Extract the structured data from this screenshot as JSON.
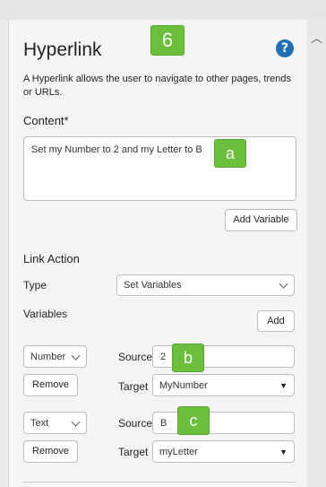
{
  "panel": {
    "title": "Hyperlink",
    "description": "A Hyperlink allows the user to navigate to other pages, trends or URLs.",
    "help_icon": "question-circle-icon"
  },
  "content": {
    "label": "Content*",
    "value": "Set my Number to 2 and my Letter to B",
    "add_variable_label": "Add Variable"
  },
  "link_action": {
    "label": "Link Action",
    "type_label": "Type",
    "type_value": "Set Variables",
    "variables_label": "Variables",
    "add_label": "Add"
  },
  "variables": [
    {
      "type": "Number",
      "source_label": "Source",
      "source": "2",
      "target_label": "Target",
      "target": "MyNumber",
      "remove_label": "Remove"
    },
    {
      "type": "Text",
      "source_label": "Source",
      "source": "B",
      "target_label": "Target",
      "target": "myLetter",
      "remove_label": "Remove"
    }
  ],
  "callouts": {
    "step": "6",
    "a": "a",
    "b": "b",
    "c": "c"
  },
  "colors": {
    "callout": "#6cbf3c",
    "help": "#1f6fb5"
  }
}
